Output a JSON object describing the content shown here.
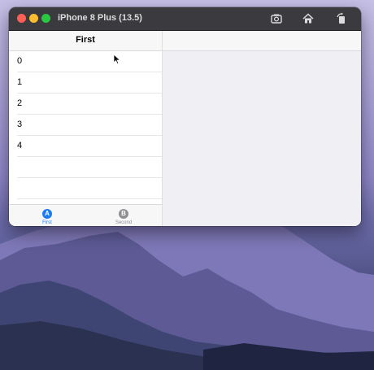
{
  "window": {
    "title": "iPhone 8 Plus (13.5)",
    "toolbar_icons": [
      "screenshot-icon",
      "home-icon",
      "rotate-icon"
    ]
  },
  "master": {
    "nav_title": "First",
    "rows": [
      "0",
      "1",
      "2",
      "3",
      "4"
    ]
  },
  "tabbar": {
    "tabs": [
      {
        "badge": "A",
        "label": "First",
        "selected": true
      },
      {
        "badge": "B",
        "label": "Second",
        "selected": false
      }
    ]
  },
  "colors": {
    "accent": "#1a7cf5",
    "inactive": "#8e8e93",
    "titlebar": "#3b3a3e",
    "detail_bg": "#efeff4"
  }
}
